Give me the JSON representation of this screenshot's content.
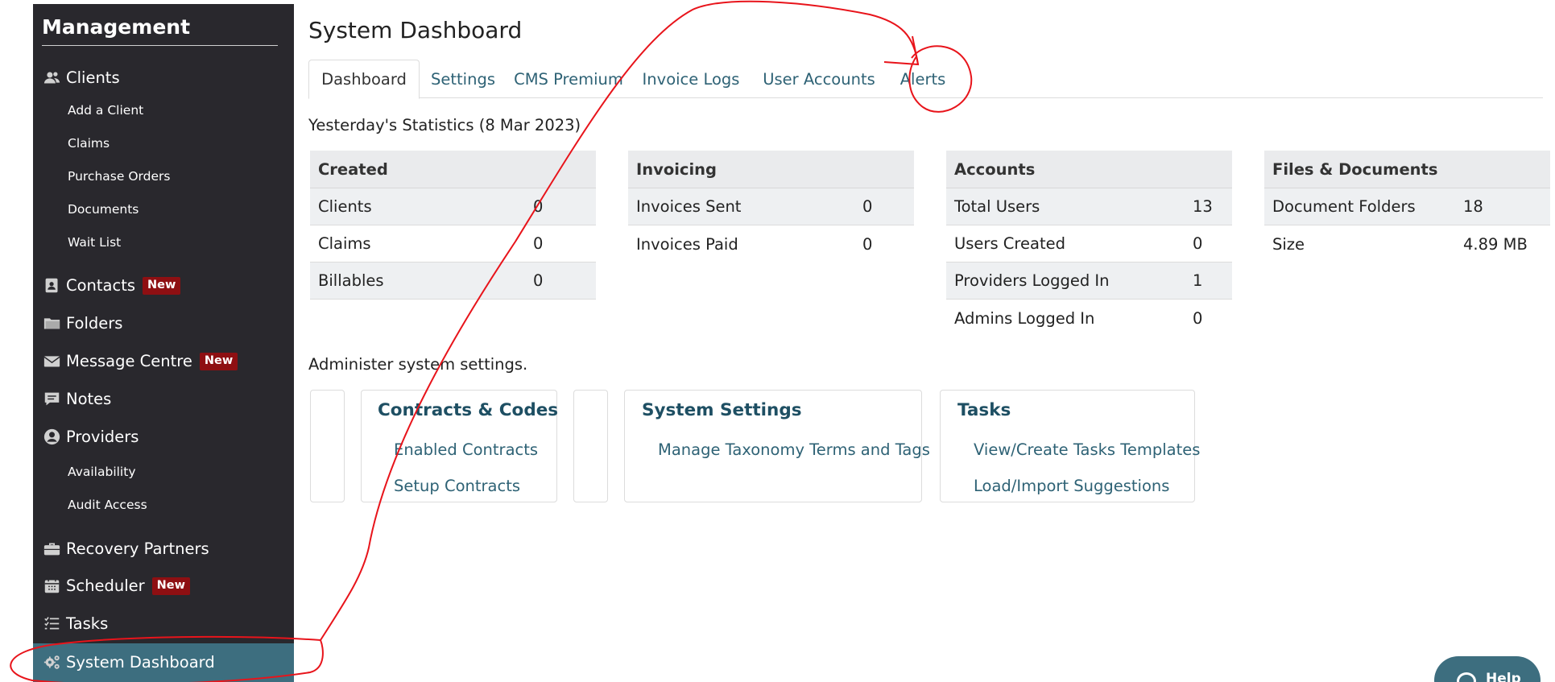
{
  "sidebar": {
    "title": "Management",
    "clients": {
      "label": "Clients",
      "icon": "users-icon"
    },
    "client_subitems": [
      "Add a Client",
      "Claims",
      "Purchase Orders",
      "Documents",
      "Wait List"
    ],
    "contacts": {
      "label": "Contacts",
      "badge": "New",
      "icon": "contact-card-icon"
    },
    "folders": {
      "label": "Folders",
      "icon": "folder-icon"
    },
    "message_centre": {
      "label": "Message Centre",
      "badge": "New",
      "icon": "envelope-icon"
    },
    "notes": {
      "label": "Notes",
      "icon": "comment-icon"
    },
    "providers": {
      "label": "Providers",
      "icon": "user-circle-icon"
    },
    "provider_subitems": [
      "Availability",
      "Audit Access"
    ],
    "recovery_partners": {
      "label": "Recovery Partners",
      "icon": "briefcase-icon"
    },
    "scheduler": {
      "label": "Scheduler",
      "badge": "New",
      "icon": "calendar-icon"
    },
    "tasks": {
      "label": "Tasks",
      "icon": "task-list-icon"
    },
    "system_dashboard": {
      "label": "System Dashboard",
      "icon": "gears-icon"
    }
  },
  "main": {
    "title": "System Dashboard",
    "tabs": [
      "Dashboard",
      "Settings",
      "CMS Premium",
      "Invoice Logs",
      "User Accounts",
      "Alerts"
    ],
    "stats_caption": "Yesterday's Statistics (8 Mar 2023)",
    "tables": [
      {
        "header": "Created",
        "rows": [
          [
            "Clients",
            "0"
          ],
          [
            "Claims",
            "0"
          ],
          [
            "Billables",
            "0"
          ]
        ]
      },
      {
        "header": "Invoicing",
        "rows": [
          [
            "Invoices Sent",
            "0"
          ],
          [
            "Invoices Paid",
            "0"
          ]
        ]
      },
      {
        "header": "Accounts",
        "rows": [
          [
            "Total Users",
            "13"
          ],
          [
            "Users Created",
            "0"
          ],
          [
            "Providers Logged In",
            "1"
          ],
          [
            "Admins Logged In",
            "0"
          ]
        ]
      },
      {
        "header": "Files & Documents",
        "rows": [
          [
            "Document Folders",
            "18"
          ],
          [
            "Size",
            "4.89 MB"
          ]
        ]
      }
    ],
    "admin_caption": "Administer system settings.",
    "cards": {
      "contracts": {
        "title": "Contracts & Codes",
        "links": [
          "Enabled Contracts",
          "Setup Contracts"
        ]
      },
      "system_settings": {
        "title": "System Settings",
        "links": [
          "Manage Taxonomy Terms and Tags"
        ]
      },
      "tasks": {
        "title": "Tasks",
        "links": [
          "View/Create Tasks Templates",
          "Load/Import Suggestions"
        ]
      }
    }
  },
  "help": {
    "label": "Help",
    "icon": "chat-icon"
  },
  "colors": {
    "sidebar_bg": "#29282d",
    "active_item": "#3d6e7f",
    "badge": "#8e0f12",
    "link": "#2e6275",
    "annotation": "#e8141b"
  }
}
